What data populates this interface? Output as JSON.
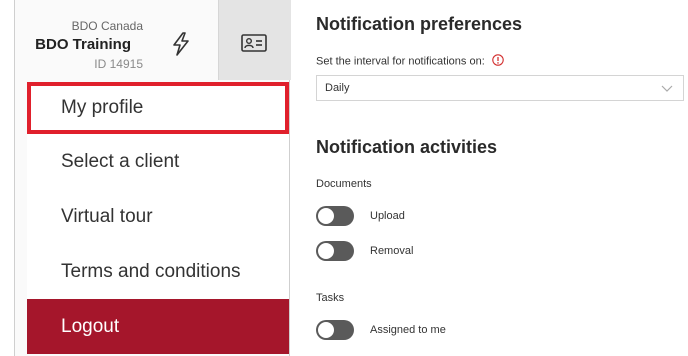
{
  "account": {
    "company": "BDO Canada",
    "name": "BDO Training",
    "id": "ID 14915"
  },
  "icons": {
    "bolt": "lightning-bolt-icon",
    "profile_card": "id-card-icon",
    "info": "info-circle-icon",
    "chevron": "chevron-down-icon"
  },
  "menu": {
    "items": [
      {
        "label": "My profile"
      },
      {
        "label": "Select a client"
      },
      {
        "label": "Virtual tour"
      },
      {
        "label": "Terms and conditions"
      }
    ],
    "logout_label": "Logout"
  },
  "notifications": {
    "title": "Notification preferences",
    "interval_label": "Set the interval for notifications on:",
    "interval_value": "Daily",
    "activities_title": "Notification activities",
    "sections": [
      {
        "name": "Documents",
        "toggles": [
          {
            "label": "Upload",
            "on": false
          },
          {
            "label": "Removal",
            "on": false
          }
        ]
      },
      {
        "name": "Tasks",
        "toggles": [
          {
            "label": "Assigned to me",
            "on": false
          }
        ]
      }
    ]
  },
  "colors": {
    "logout_bg": "#a5162b",
    "highlight_border": "#e0202c",
    "toggle_off": "#5a5a5a",
    "info_red": "#d32f2f"
  }
}
